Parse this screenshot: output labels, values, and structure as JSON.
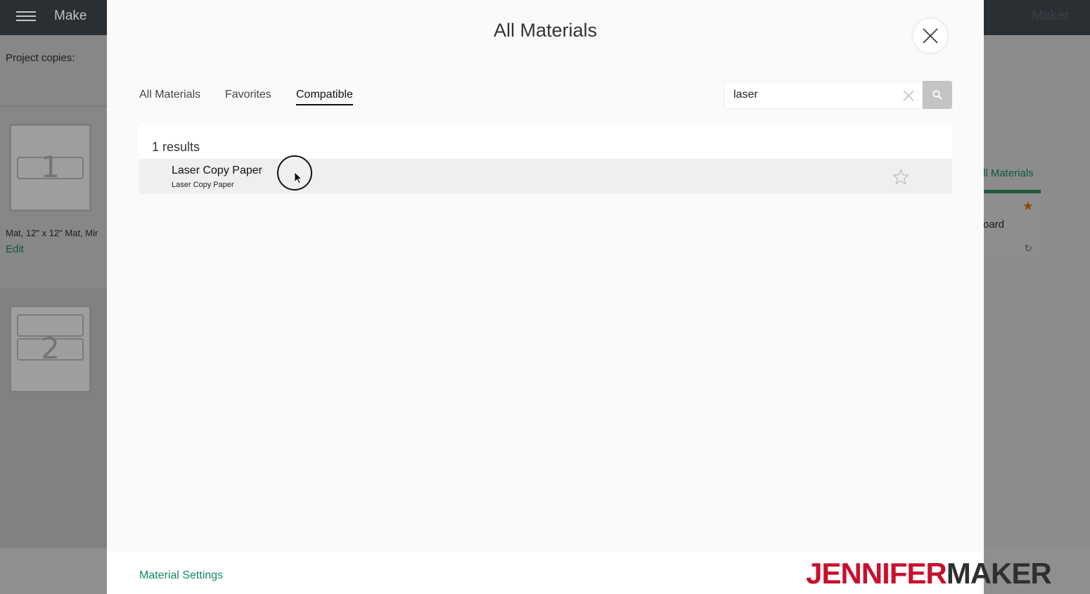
{
  "app": {
    "menu_icon": "hamburger-icon",
    "title": "Make",
    "right_label": "Maker"
  },
  "left_panel": {
    "project_copies_label": "Project copies:",
    "mats": [
      {
        "number": "1"
      },
      {
        "number": "2"
      }
    ],
    "mat_info": "Mat, 12\" x 12\" Mat, Mir",
    "edit_label": "Edit"
  },
  "right_panel": {
    "materials_link": "ll Materials",
    "card_title": "oard"
  },
  "modal": {
    "title": "All Materials",
    "close_icon": "close-icon",
    "tabs": [
      {
        "label": "All Materials",
        "active": false
      },
      {
        "label": "Favorites",
        "active": false
      },
      {
        "label": "Compatible",
        "active": true
      }
    ],
    "search": {
      "value": "laser",
      "clear_icon": "clear-icon",
      "search_icon": "search-icon"
    },
    "results_count": "1 results",
    "results": [
      {
        "name": "Laser Copy Paper",
        "subtitle": "Laser Copy Paper",
        "favorite": false
      }
    ],
    "footer": {
      "material_settings_label": "Material Settings"
    }
  },
  "watermark": {
    "part1": "JENNIFER",
    "part2": "MAKER"
  },
  "colors": {
    "accent_green": "#148a63",
    "topbar": "#2a2f33",
    "watermark_red": "#c8102e"
  }
}
